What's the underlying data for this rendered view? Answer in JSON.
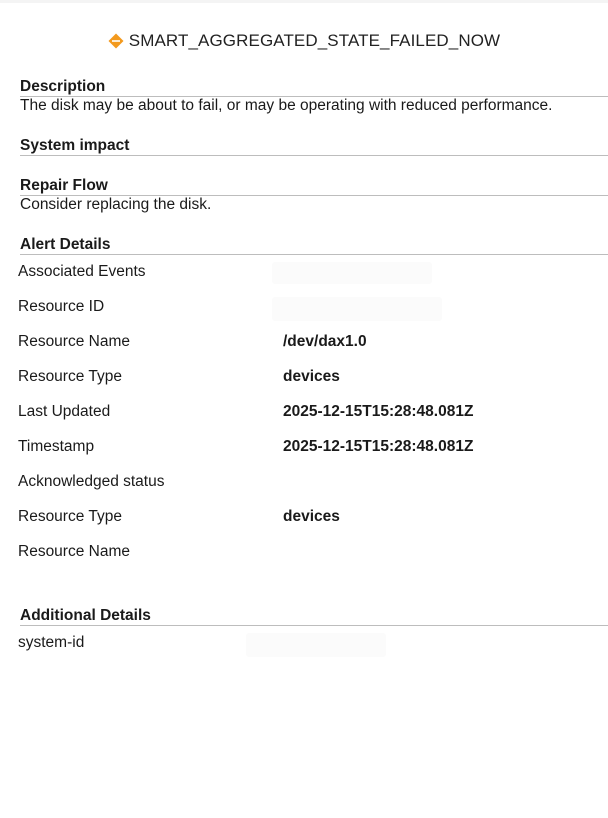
{
  "alert": {
    "title": "SMART_AGGREGATED_STATE_FAILED_NOW",
    "severity_icon": "warning-diamond-icon",
    "severity_color": "#f39a1e"
  },
  "sections": {
    "description": {
      "heading": "Description",
      "text": "The disk may be about to fail, or may be operating with reduced performance."
    },
    "system_impact": {
      "heading": "System impact",
      "text": ""
    },
    "repair_flow": {
      "heading": "Repair Flow",
      "text": "Consider replacing the disk."
    },
    "alert_details": {
      "heading": "Alert Details",
      "rows": [
        {
          "label": "Associated Events",
          "value": ""
        },
        {
          "label": "Resource ID",
          "value": ""
        },
        {
          "label": "Resource Name",
          "value": "/dev/dax1.0"
        },
        {
          "label": "Resource Type",
          "value": "devices"
        },
        {
          "label": "Last Updated",
          "value": "2025-12-15T15:28:48.081Z"
        },
        {
          "label": "Timestamp",
          "value": "2025-12-15T15:28:48.081Z"
        },
        {
          "label": "Acknowledged status",
          "value": ""
        },
        {
          "label": "Resource Type",
          "value": "devices"
        },
        {
          "label": "Resource Name",
          "value": ""
        }
      ]
    },
    "additional_details": {
      "heading": "Additional Details",
      "rows": [
        {
          "label": "system-id",
          "value": ""
        }
      ]
    }
  },
  "colors": {
    "divider": "#bdbdbd",
    "text": "#1a1a1a"
  }
}
